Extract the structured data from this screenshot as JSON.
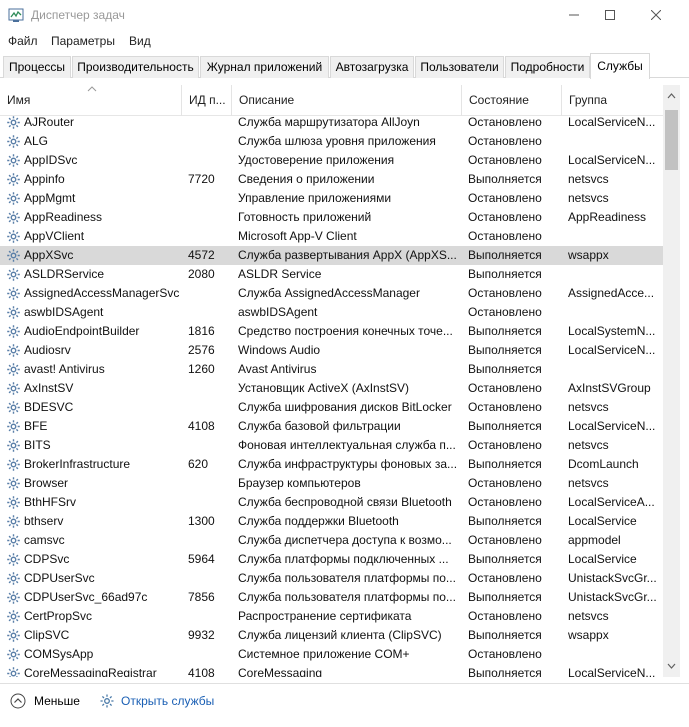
{
  "window": {
    "title": "Диспетчер задач",
    "icon": "task-manager-icon"
  },
  "menu": [
    "Файл",
    "Параметры",
    "Вид"
  ],
  "tabs": [
    {
      "label": "Процессы"
    },
    {
      "label": "Производительность"
    },
    {
      "label": "Журнал приложений"
    },
    {
      "label": "Автозагрузка"
    },
    {
      "label": "Пользователи"
    },
    {
      "label": "Подробности"
    },
    {
      "label": "Службы",
      "active": true
    }
  ],
  "table": {
    "columns": [
      "Имя",
      "ИД п...",
      "Описание",
      "Состояние",
      "Группа"
    ],
    "sorted_by": "Имя",
    "selected_row": "AppXSvc",
    "rows": [
      {
        "name": "AJRouter",
        "pid": "",
        "desc": "Служба маршрутизатора AllJoyn",
        "state": "Остановлено",
        "group": "LocalServiceN..."
      },
      {
        "name": "ALG",
        "pid": "",
        "desc": "Служба шлюза уровня приложения",
        "state": "Остановлено",
        "group": ""
      },
      {
        "name": "AppIDSvc",
        "pid": "",
        "desc": "Удостоверение приложения",
        "state": "Остановлено",
        "group": "LocalServiceN..."
      },
      {
        "name": "Appinfo",
        "pid": "7720",
        "desc": "Сведения о приложении",
        "state": "Выполняется",
        "group": "netsvcs"
      },
      {
        "name": "AppMgmt",
        "pid": "",
        "desc": "Управление приложениями",
        "state": "Остановлено",
        "group": "netsvcs"
      },
      {
        "name": "AppReadiness",
        "pid": "",
        "desc": "Готовность приложений",
        "state": "Остановлено",
        "group": "AppReadiness"
      },
      {
        "name": "AppVClient",
        "pid": "",
        "desc": "Microsoft App-V Client",
        "state": "Остановлено",
        "group": ""
      },
      {
        "name": "AppXSvc",
        "pid": "4572",
        "desc": "Служба развертывания AppX (AppXS...",
        "state": "Выполняется",
        "group": "wsappx"
      },
      {
        "name": "ASLDRService",
        "pid": "2080",
        "desc": "ASLDR Service",
        "state": "Выполняется",
        "group": ""
      },
      {
        "name": "AssignedAccessManagerSvc",
        "pid": "",
        "desc": "Служба AssignedAccessManager",
        "state": "Остановлено",
        "group": "AssignedAcce..."
      },
      {
        "name": "aswbIDSAgent",
        "pid": "",
        "desc": "aswbIDSAgent",
        "state": "Остановлено",
        "group": ""
      },
      {
        "name": "AudioEndpointBuilder",
        "pid": "1816",
        "desc": "Средство построения конечных точе...",
        "state": "Выполняется",
        "group": "LocalSystemN..."
      },
      {
        "name": "Audiosrv",
        "pid": "2576",
        "desc": "Windows Audio",
        "state": "Выполняется",
        "group": "LocalServiceN..."
      },
      {
        "name": "avast! Antivirus",
        "pid": "1260",
        "desc": "Avast Antivirus",
        "state": "Выполняется",
        "group": ""
      },
      {
        "name": "AxInstSV",
        "pid": "",
        "desc": "Установщик ActiveX (AxInstSV)",
        "state": "Остановлено",
        "group": "AxInstSVGroup"
      },
      {
        "name": "BDESVC",
        "pid": "",
        "desc": "Служба шифрования дисков BitLocker",
        "state": "Остановлено",
        "group": "netsvcs"
      },
      {
        "name": "BFE",
        "pid": "4108",
        "desc": "Служба базовой фильтрации",
        "state": "Выполняется",
        "group": "LocalServiceN..."
      },
      {
        "name": "BITS",
        "pid": "",
        "desc": "Фоновая интеллектуальная служба п...",
        "state": "Остановлено",
        "group": "netsvcs"
      },
      {
        "name": "BrokerInfrastructure",
        "pid": "620",
        "desc": "Служба инфраструктуры фоновых за...",
        "state": "Выполняется",
        "group": "DcomLaunch"
      },
      {
        "name": "Browser",
        "pid": "",
        "desc": "Браузер компьютеров",
        "state": "Остановлено",
        "group": "netsvcs"
      },
      {
        "name": "BthHFSrv",
        "pid": "",
        "desc": "Служба беспроводной связи Bluetooth",
        "state": "Остановлено",
        "group": "LocalServiceA..."
      },
      {
        "name": "bthserv",
        "pid": "1300",
        "desc": "Служба поддержки Bluetooth",
        "state": "Выполняется",
        "group": "LocalService"
      },
      {
        "name": "camsvc",
        "pid": "",
        "desc": "Служба диспетчера доступа к возмо...",
        "state": "Остановлено",
        "group": "appmodel"
      },
      {
        "name": "CDPSvc",
        "pid": "5964",
        "desc": "Служба платформы подключенных ...",
        "state": "Выполняется",
        "group": "LocalService"
      },
      {
        "name": "CDPUserSvc",
        "pid": "",
        "desc": "Служба пользователя платформы по...",
        "state": "Остановлено",
        "group": "UnistackSvcGr..."
      },
      {
        "name": "CDPUserSvc_66ad97c",
        "pid": "7856",
        "desc": "Служба пользователя платформы по...",
        "state": "Выполняется",
        "group": "UnistackSvcGr..."
      },
      {
        "name": "CertPropSvc",
        "pid": "",
        "desc": "Распространение сертификата",
        "state": "Остановлено",
        "group": "netsvcs"
      },
      {
        "name": "ClipSVC",
        "pid": "9932",
        "desc": "Служба лицензий клиента (ClipSVC)",
        "state": "Выполняется",
        "group": "wsappx"
      },
      {
        "name": "COMSysApp",
        "pid": "",
        "desc": "Системное приложение COM+",
        "state": "Остановлено",
        "group": ""
      },
      {
        "name": "CoreMessagingRegistrar",
        "pid": "4108",
        "desc": "CoreMessaging",
        "state": "Выполняется",
        "group": "LocalServiceN..."
      }
    ]
  },
  "footer": {
    "less_label": "Меньше",
    "open_services_label": "Открыть службы"
  },
  "colors": {
    "link": "#1a5fb4",
    "selected_row": "#d9d9d9",
    "gear": "#5a7fa8"
  }
}
